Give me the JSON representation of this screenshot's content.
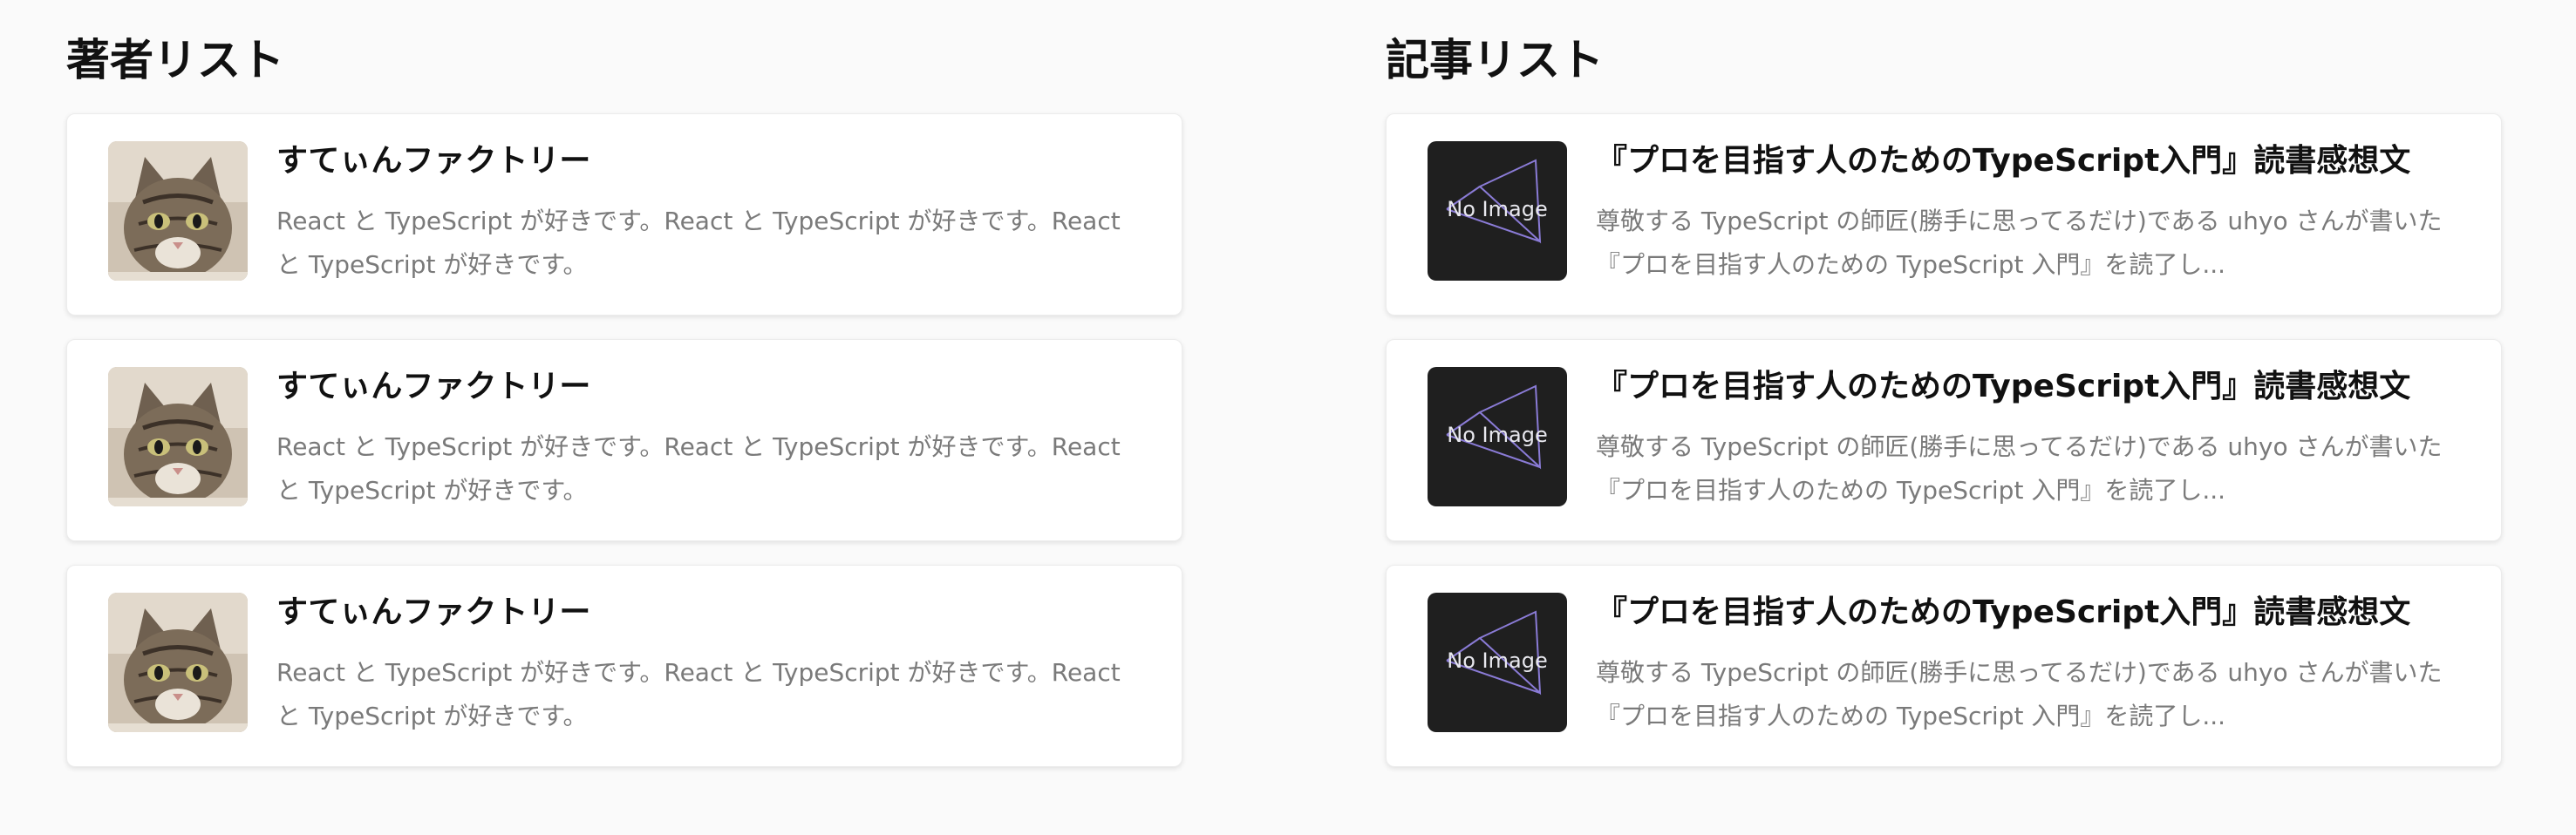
{
  "authors": {
    "title": "著者リスト",
    "items": [
      {
        "name": "すてぃんファクトリー",
        "bio": "React と TypeScript が好きです。React と TypeScript が好きです。React と TypeScript が好きです。",
        "avatar_icon": "cat-photo-icon"
      },
      {
        "name": "すてぃんファクトリー",
        "bio": "React と TypeScript が好きです。React と TypeScript が好きです。React と TypeScript が好きです。",
        "avatar_icon": "cat-photo-icon"
      },
      {
        "name": "すてぃんファクトリー",
        "bio": "React と TypeScript が好きです。React と TypeScript が好きです。React と TypeScript が好きです。",
        "avatar_icon": "cat-photo-icon"
      }
    ]
  },
  "articles": {
    "title": "記事リスト",
    "items": [
      {
        "title": "『プロを目指す人のためのTypeScript入門』読書感想文",
        "excerpt": "尊敬する TypeScript の師匠(勝手に思ってるだけ)である uhyo さんが書いた『プロを目指す人のための TypeScript 入門』を読了し...",
        "thumbnail_text": "No Image"
      },
      {
        "title": "『プロを目指す人のためのTypeScript入門』読書感想文",
        "excerpt": "尊敬する TypeScript の師匠(勝手に思ってるだけ)である uhyo さんが書いた『プロを目指す人のための TypeScript 入門』を読了し...",
        "thumbnail_text": "No Image"
      },
      {
        "title": "『プロを目指す人のためのTypeScript入門』読書感想文",
        "excerpt": "尊敬する TypeScript の師匠(勝手に思ってるだけ)である uhyo さんが書いた『プロを目指す人のための TypeScript 入門』を読了し...",
        "thumbnail_text": "No Image"
      }
    ]
  },
  "colors": {
    "background": "#fafafa",
    "card": "#ffffff",
    "text": "#111111",
    "muted_text": "#7a7a7a",
    "thumbnail_bg": "#1f1f1f",
    "thumbnail_accent": "#8a7bd6"
  }
}
